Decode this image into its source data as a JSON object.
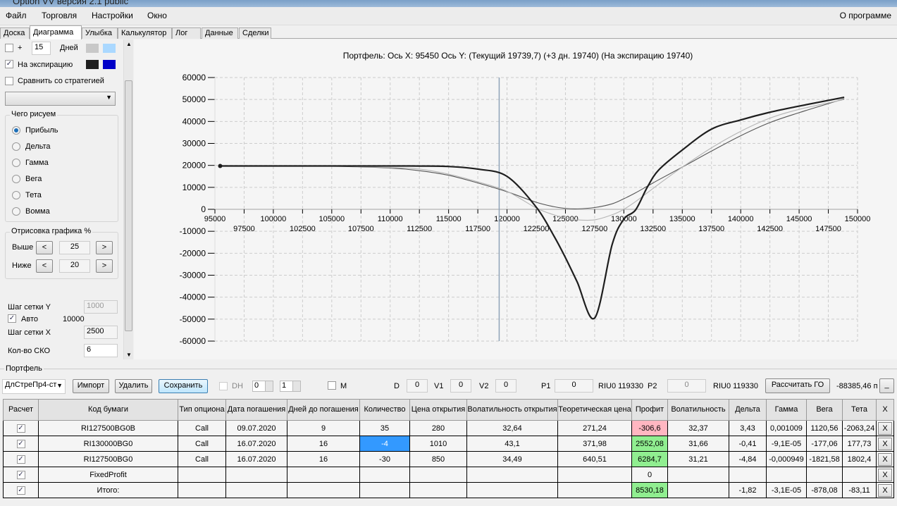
{
  "window": {
    "title": "Option VV версия 2.1 public"
  },
  "menu": {
    "items": [
      "Файл",
      "Торговля",
      "Настройки",
      "Окно"
    ],
    "about": "О программе"
  },
  "tabs": [
    "Доска",
    "Диаграмма",
    "Улыбка",
    "Калькулятор",
    "Лог",
    "Данные",
    "Сделки"
  ],
  "active_tab": "Диаграмма",
  "left": {
    "plus_label": "+",
    "days_value": "15",
    "days_label": "Дней",
    "expiration_label": "На экспирацию",
    "compare_label": "Сравнить со стратегией",
    "colors": {
      "days_a": "#c8c8c8",
      "days_b": "#aad8ff",
      "exp_a": "#1e1e1e",
      "exp_b": "#0000c8"
    },
    "draw_group": "Чего рисуем",
    "radios": [
      "Прибыль",
      "Дельта",
      "Гамма",
      "Вега",
      "Тета",
      "Вомма"
    ],
    "selected_radio": "Прибыль",
    "render_group": "Отрисовка графика %",
    "above_label": "Выше",
    "above_value": "25",
    "below_label": "Ниже",
    "below_value": "20",
    "prev": "<",
    "next": ">",
    "grid_y_label": "Шаг сетки Y",
    "grid_y_value": "1000",
    "auto_label": "Авто",
    "auto_value": "10000",
    "grid_x_label": "Шаг сетки X",
    "grid_x_value": "2500",
    "sko_label": "Кол-во СКО",
    "sko_value": "6"
  },
  "chart_data": {
    "type": "line",
    "title": "Портфель: Ось X: 95450 Ось Y:  (Текущий 19739,7)  (+3 дн. 19740)  (На экспирацию 19740)",
    "xlim": [
      95000,
      150000
    ],
    "ylim": [
      -60000,
      60000
    ],
    "xticks_row1": [
      95000,
      100000,
      105000,
      110000,
      115000,
      120000,
      125000,
      130000,
      135000,
      140000,
      145000,
      150000
    ],
    "xticks_row2": [
      97500,
      102500,
      107500,
      112500,
      117500,
      122500,
      127500,
      132500,
      137500,
      142500,
      147500
    ],
    "yticks": [
      60000,
      50000,
      40000,
      30000,
      20000,
      10000,
      0,
      -10000,
      -20000,
      -30000,
      -40000,
      -50000,
      -60000
    ],
    "grid": true,
    "vertical_marker": 119330,
    "x": [
      95450,
      100000,
      105000,
      110000,
      112500,
      115000,
      117500,
      120000,
      122500,
      124000,
      125000,
      126000,
      127500,
      129000,
      130000,
      131000,
      132000,
      133000,
      135000,
      137500,
      140000,
      142500,
      145000,
      148860
    ],
    "series": [
      {
        "name": "Текущий",
        "color": "#555555",
        "values": [
          19740,
          19700,
          19600,
          18800,
          17600,
          15500,
          12000,
          8000,
          3200,
          1200,
          400,
          200,
          800,
          2500,
          4800,
          7500,
          10500,
          13500,
          19200,
          26500,
          33500,
          39500,
          44000,
          50300
        ]
      },
      {
        "name": "+3 дн.",
        "color": "#b4b4b4",
        "values": [
          19740,
          19740,
          19700,
          19000,
          18300,
          16000,
          12500,
          8200,
          600,
          -2500,
          -4000,
          -4800,
          -4800,
          -2500,
          0,
          3500,
          7500,
          11500,
          19200,
          28000,
          35500,
          41500,
          45500,
          50000
        ]
      },
      {
        "name": "На экспирацию",
        "color": "#1e1e1e",
        "values": [
          19740,
          19740,
          19740,
          19740,
          19700,
          19500,
          18300,
          15000,
          1000,
          -12000,
          -22000,
          -33000,
          -49500,
          -16000,
          -4500,
          -300,
          10000,
          18000,
          27000,
          36500,
          40700,
          44200,
          47000,
          51000
        ]
      }
    ]
  },
  "portfolio": {
    "group_label": "Портфель",
    "strategy": "ДлСтреПр4-ст",
    "import": "Импорт",
    "delete": "Удалить",
    "save": "Сохранить",
    "dh_label": "DH",
    "spin1": "0",
    "spin2": "1",
    "m_label": "M",
    "d_label": "D",
    "d_value": "0",
    "v1_label": "V1",
    "v1_value": "0",
    "v2_label": "V2",
    "v2_value": "0",
    "p1_label": "P1",
    "p1_value": "0",
    "p1_ticker": "RIU0 119330",
    "p2_label": "P2",
    "p2_value": "0",
    "p2_ticker": "RIU0 119330",
    "calc_go": "Рассчитать ГО",
    "go_value": "-88385,46 п",
    "minimize": "_"
  },
  "table": {
    "headers": [
      "Расчет",
      "Код бумаги",
      "Тип опциона",
      "Дата погашения",
      "Дней до погашения",
      "Количество",
      "Цена открытия",
      "Волатильность открытия",
      "Теоретическая цена",
      "Профит",
      "Волатильность",
      "Дельта",
      "Гамма",
      "Вега",
      "Тета",
      "X"
    ],
    "rows": [
      [
        "RI127500BG0B",
        "Call",
        "09.07.2020",
        "9",
        "35",
        "280",
        "32,64",
        "271,24",
        "-306,6",
        "32,37",
        "3,43",
        "0,001009",
        "1120,56",
        "-2063,24"
      ],
      [
        "RI130000BG0",
        "Call",
        "16.07.2020",
        "16",
        "-4",
        "1010",
        "43,1",
        "371,98",
        "2552,08",
        "31,66",
        "-0,41",
        "-9,1E-05",
        "-177,06",
        "177,73"
      ],
      [
        "RI127500BG0",
        "Call",
        "16.07.2020",
        "16",
        "-30",
        "850",
        "34,49",
        "640,51",
        "6284,7",
        "31,21",
        "-4,84",
        "-0,000949",
        "-1821,58",
        "1802,4"
      ],
      [
        "FixedProfit",
        "",
        "",
        "",
        "",
        "",
        "",
        "",
        "0",
        "",
        "",
        "",
        "",
        ""
      ],
      [
        "Итого:",
        "",
        "",
        "",
        "",
        "",
        "",
        "",
        "8530,18",
        "",
        "-1,82",
        "-3,1E-05",
        "-878,08",
        "-83,11"
      ]
    ],
    "delete_label": "X",
    "check": "✓"
  }
}
